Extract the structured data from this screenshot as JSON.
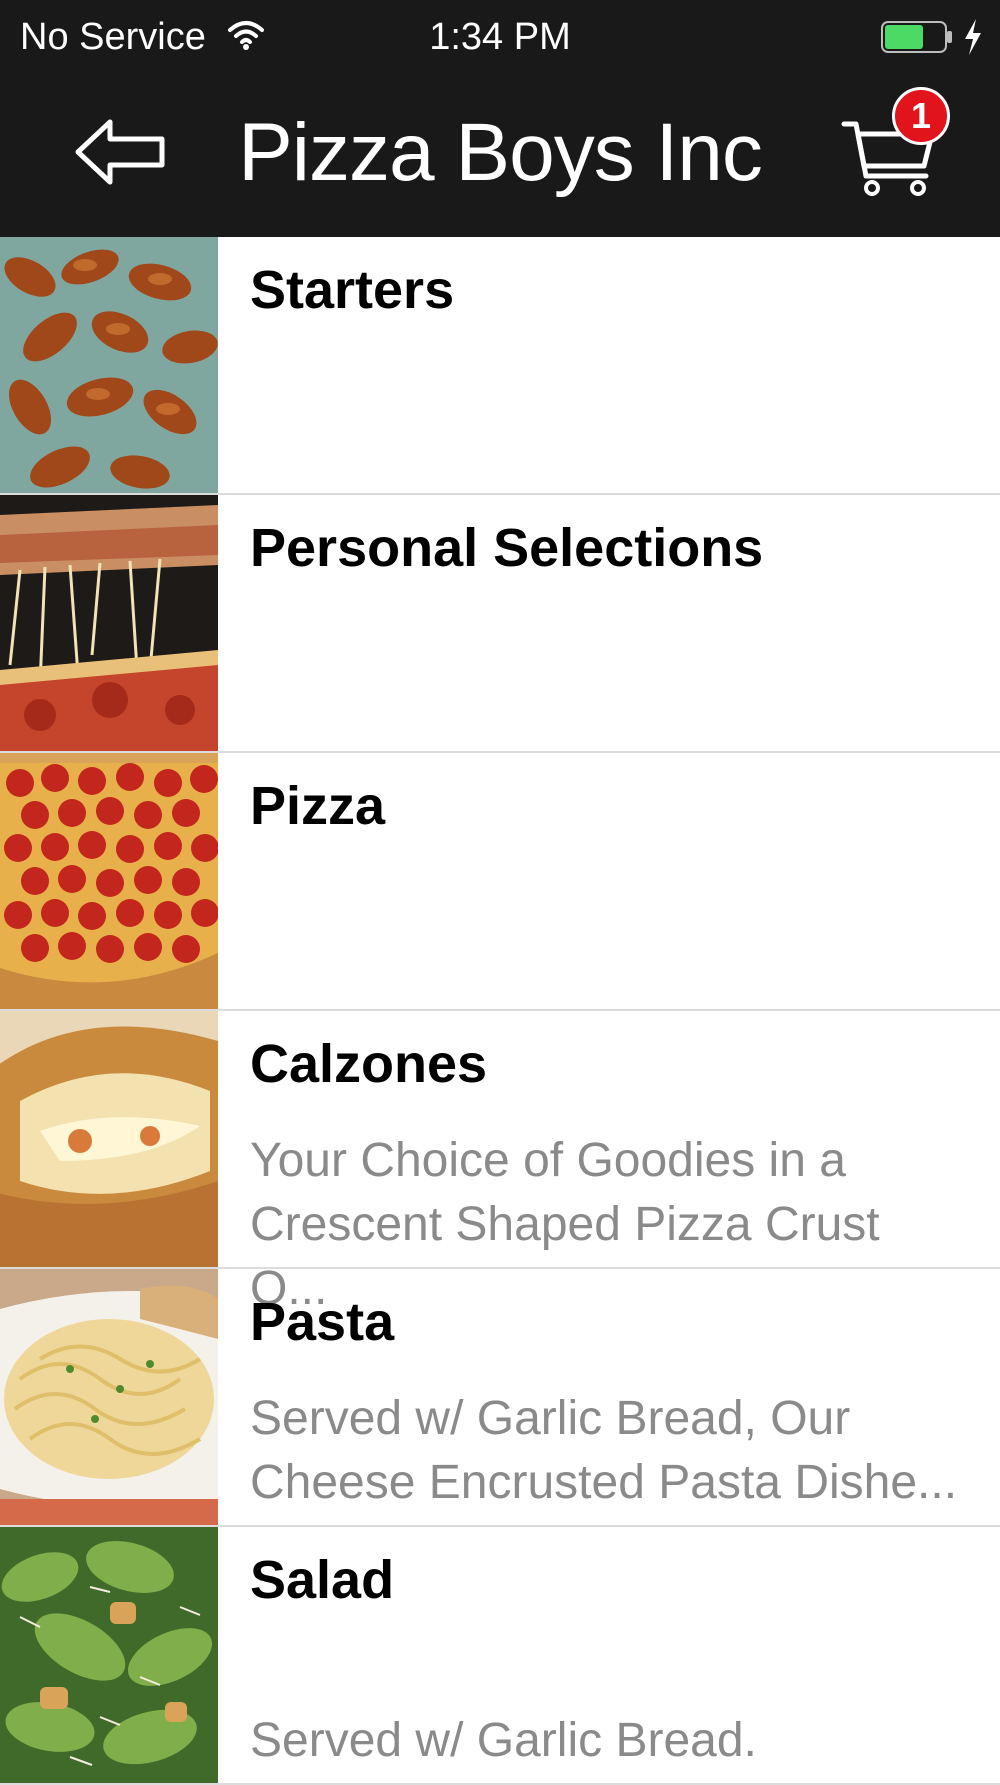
{
  "status_bar": {
    "carrier": "No Service",
    "time": "1:34 PM"
  },
  "header": {
    "title": "Pizza Boys Inc",
    "cart_count": "1"
  },
  "categories": [
    {
      "name": "Starters",
      "description": "",
      "image": "wings-photo"
    },
    {
      "name": "Personal Selections",
      "description": "",
      "image": "pizza-slice-photo"
    },
    {
      "name": "Pizza",
      "description": "",
      "image": "pepperoni-pizza-photo"
    },
    {
      "name": "Calzones",
      "description": "Your Choice of Goodies in a\nCrescent Shaped Pizza Crust O...",
      "image": "calzone-photo"
    },
    {
      "name": "Pasta",
      "description": "Served w/ Garlic Bread, Our\nCheese Encrusted  Pasta Dishe...",
      "image": "pasta-photo"
    },
    {
      "name": "Salad",
      "description": "\nServed w/ Garlic Bread.",
      "image": "salad-photo"
    }
  ],
  "colors": {
    "header_bg": "#191919",
    "badge": "#e0141a",
    "battery": "#4cd964",
    "description": "#8a8a8a"
  }
}
